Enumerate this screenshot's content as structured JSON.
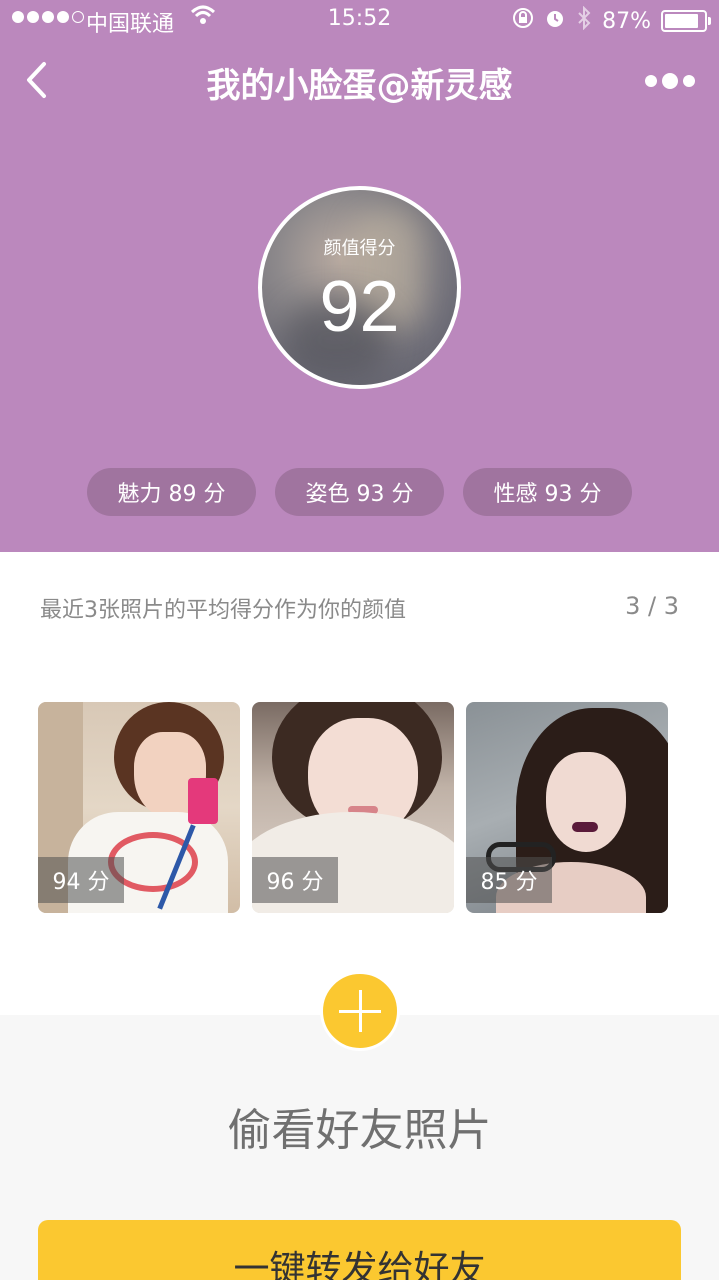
{
  "status_bar": {
    "carrier": "中国联通",
    "time": "15:52",
    "battery": "87%",
    "battery_level": 0.87
  },
  "nav": {
    "title": "我的小脸蛋@新灵感"
  },
  "score": {
    "label": "颜值得分",
    "value": "92"
  },
  "sub_scores": [
    {
      "label": "魅力 89 分"
    },
    {
      "label": "姿色 93 分"
    },
    {
      "label": "性感 93 分"
    }
  ],
  "info": {
    "description": "最近3张照片的平均得分作为你的颜值",
    "count": "3 / 3"
  },
  "photos": [
    {
      "score": "94 分"
    },
    {
      "score": "96 分"
    },
    {
      "score": "85 分"
    }
  ],
  "peek": {
    "title": "偷看好友照片"
  },
  "forward_button": {
    "label": "一键转发给好友"
  },
  "colors": {
    "header_bg": "#bb88bd",
    "pill_bg": "#a0749f",
    "accent_yellow": "#fbc830"
  },
  "icons": [
    "signal-dots-icon",
    "wifi-icon",
    "back-chevron-icon",
    "more-dots-icon",
    "lock-rotation-icon",
    "alarm-icon",
    "bluetooth-icon",
    "battery-icon",
    "plus-icon"
  ]
}
